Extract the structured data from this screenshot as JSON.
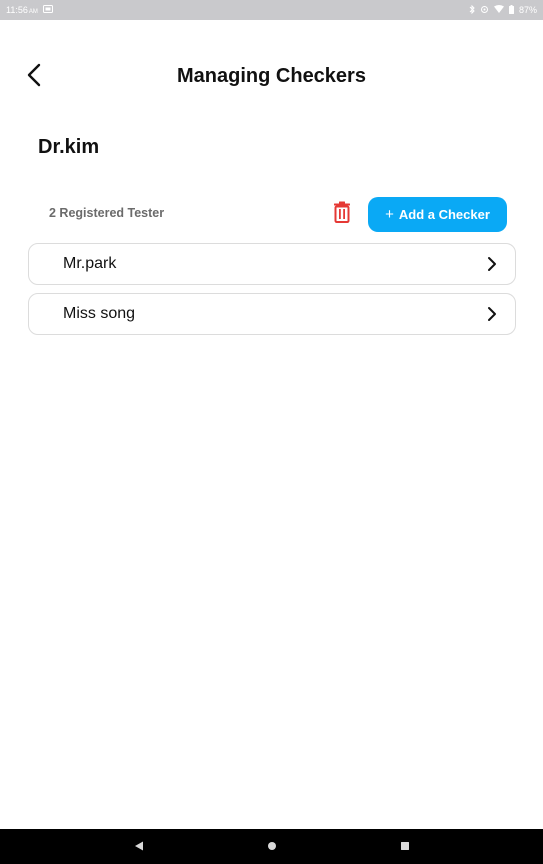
{
  "status_bar": {
    "time": "11:56",
    "ampm": "AM",
    "battery": "87%"
  },
  "header": {
    "title": "Managing Checkers",
    "back_icon": "chevron-left-icon"
  },
  "group": {
    "name": "Dr.kim"
  },
  "toolbar": {
    "count_label": "2 Registered Tester",
    "delete_icon": "trash-icon",
    "add_plus": "+",
    "add_label": "Add a Checker"
  },
  "checkers": [
    {
      "name": "Mr.park"
    },
    {
      "name": "Miss song"
    }
  ],
  "colors": {
    "accent": "#0aa9f5",
    "delete": "#e53935",
    "status_bar": "#c9c9cc",
    "nav_bar": "#000000"
  },
  "nav": {
    "back_icon": "triangle-back-icon",
    "home_icon": "circle-home-icon",
    "recents_icon": "square-recents-icon"
  }
}
